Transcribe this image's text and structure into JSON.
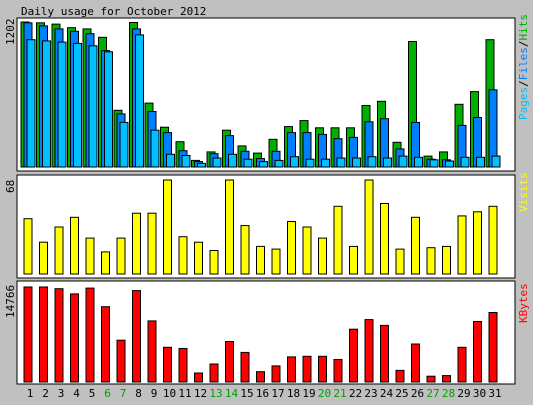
{
  "title": "Daily usage for October 2012",
  "colors": {
    "background": "#c0c0c0",
    "panel": "#ffffff",
    "hits": "#00b000",
    "files": "#0080ff",
    "pages": "#00c0ff",
    "visits": "#ffff00",
    "kbytes": "#ff0000",
    "weekday_label": "#000000",
    "weekend_label": "#00a000"
  },
  "chart_data": [
    {
      "type": "bar",
      "panel": "hits-files-pages",
      "ymax_label": "1202",
      "ylim": [
        0,
        1202
      ],
      "legend": [
        "Pages",
        "Files",
        "Hits"
      ],
      "categories": [
        "1",
        "2",
        "3",
        "4",
        "5",
        "6",
        "7",
        "8",
        "9",
        "10",
        "11",
        "12",
        "13",
        "14",
        "15",
        "16",
        "17",
        "18",
        "19",
        "20",
        "21",
        "22",
        "23",
        "24",
        "25",
        "26",
        "27",
        "28",
        "29",
        "30",
        "31"
      ],
      "weekend_days": [
        "6",
        "7",
        "13",
        "14",
        "20",
        "21",
        "27",
        "28"
      ],
      "series": [
        {
          "name": "Hits",
          "values": [
            1202,
            1195,
            1185,
            1155,
            1145,
            1075,
            470,
            1198,
            530,
            330,
            210,
            55,
            125,
            305,
            175,
            115,
            230,
            335,
            385,
            325,
            325,
            325,
            510,
            545,
            205,
            1040,
            90,
            125,
            520,
            625,
            1055
          ]
        },
        {
          "name": "Files",
          "values": [
            1195,
            1170,
            1145,
            1125,
            1105,
            965,
            440,
            1145,
            460,
            285,
            135,
            45,
            110,
            260,
            130,
            70,
            130,
            285,
            285,
            270,
            235,
            245,
            375,
            400,
            150,
            370,
            65,
            60,
            345,
            410,
            640
          ]
        },
        {
          "name": "Pages",
          "values": [
            1055,
            1045,
            1035,
            1025,
            1005,
            955,
            370,
            1095,
            305,
            105,
            95,
            30,
            75,
            105,
            65,
            45,
            55,
            85,
            65,
            65,
            75,
            75,
            85,
            75,
            90,
            80,
            60,
            50,
            80,
            80,
            90
          ]
        }
      ]
    },
    {
      "type": "bar",
      "panel": "visits",
      "ymax_label": "68",
      "ylim": [
        0,
        68
      ],
      "legend": [
        "Visits"
      ],
      "categories": [
        "1",
        "2",
        "3",
        "4",
        "5",
        "6",
        "7",
        "8",
        "9",
        "10",
        "11",
        "12",
        "13",
        "14",
        "15",
        "16",
        "17",
        "18",
        "19",
        "20",
        "21",
        "22",
        "23",
        "24",
        "25",
        "26",
        "27",
        "28",
        "29",
        "30",
        "31"
      ],
      "series": [
        {
          "name": "Visits",
          "values": [
            40,
            23,
            34,
            41,
            26,
            16,
            26,
            44,
            44,
            68,
            27,
            23,
            17,
            68,
            35,
            20,
            18,
            38,
            34,
            26,
            49,
            20,
            68,
            51,
            18,
            41,
            19,
            20,
            42,
            45,
            49
          ]
        }
      ]
    },
    {
      "type": "bar",
      "panel": "kbytes",
      "ymax_label": "14766",
      "ylim": [
        0,
        14766
      ],
      "legend": [
        "KBytes"
      ],
      "categories": [
        "1",
        "2",
        "3",
        "4",
        "5",
        "6",
        "7",
        "8",
        "9",
        "10",
        "11",
        "12",
        "13",
        "14",
        "15",
        "16",
        "17",
        "18",
        "19",
        "20",
        "21",
        "22",
        "23",
        "24",
        "25",
        "26",
        "27",
        "28",
        "29",
        "30",
        "31"
      ],
      "series": [
        {
          "name": "KBytes",
          "values": [
            14766,
            14766,
            14500,
            13700,
            14600,
            11700,
            6500,
            14200,
            9500,
            5400,
            5200,
            1400,
            2800,
            6300,
            4600,
            1600,
            2500,
            3900,
            4000,
            4000,
            3500,
            8200,
            9700,
            8800,
            1800,
            5900,
            900,
            1000,
            5400,
            9400,
            10800
          ]
        }
      ]
    }
  ]
}
